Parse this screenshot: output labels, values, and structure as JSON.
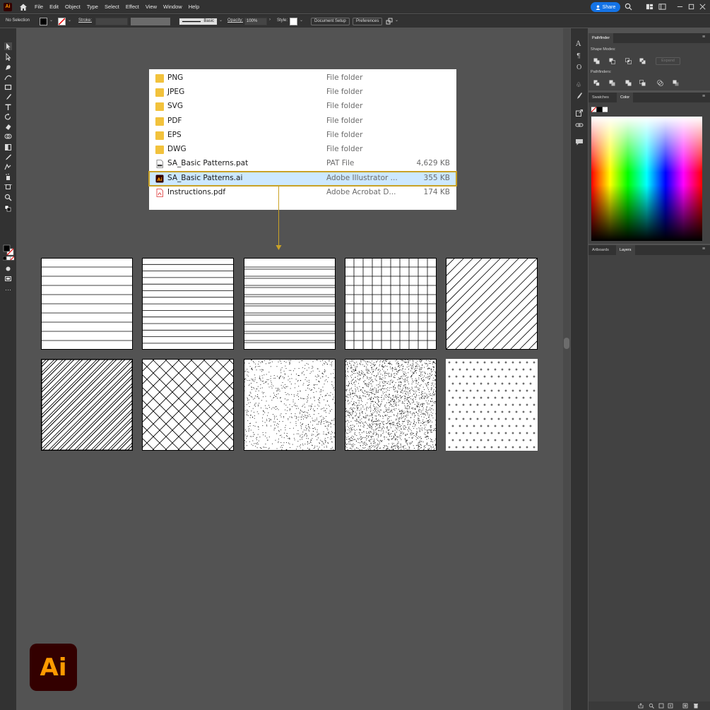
{
  "menubar": {
    "app_icon": "Ai",
    "items": [
      "File",
      "Edit",
      "Object",
      "Type",
      "Select",
      "Effect",
      "View",
      "Window",
      "Help"
    ],
    "share_label": "Share"
  },
  "control_bar": {
    "selection_status": "No Selection",
    "stroke_label": "Stroke:",
    "brush_label": "Basic",
    "opacity_label": "Opacity:",
    "opacity_value": "100%",
    "style_label": "Style:",
    "document_setup_label": "Document Setup",
    "preferences_label": "Preferences"
  },
  "explorer": {
    "rows": [
      {
        "name": "PNG",
        "type": "File folder",
        "size": "",
        "icon": "folder-icon"
      },
      {
        "name": "JPEG",
        "type": "File folder",
        "size": "",
        "icon": "folder-icon"
      },
      {
        "name": "SVG",
        "type": "File folder",
        "size": "",
        "icon": "folder-icon"
      },
      {
        "name": "PDF",
        "type": "File folder",
        "size": "",
        "icon": "folder-icon"
      },
      {
        "name": "EPS",
        "type": "File folder",
        "size": "",
        "icon": "folder-icon"
      },
      {
        "name": "DWG",
        "type": "File folder",
        "size": "",
        "icon": "folder-icon"
      },
      {
        "name": "SA_Basic Patterns.pat",
        "type": "PAT File",
        "size": "4,629 KB",
        "icon": "pat-file-icon"
      },
      {
        "name": "SA_Basic Patterns.ai",
        "type": "Adobe Illustrator ...",
        "size": "355 KB",
        "icon": "illustrator-file-icon",
        "selected": true
      },
      {
        "name": "Instructions.pdf",
        "type": "Adobe Acrobat D...",
        "size": "174 KB",
        "icon": "pdf-file-icon"
      }
    ]
  },
  "patterns": [
    "horizontal-lines-wide",
    "horizontal-lines-medium",
    "horizontal-lines-double",
    "grid",
    "diagonal-lines",
    "diagonal-lines-dense",
    "crosshatch",
    "stipple-light",
    "stipple-dense",
    "plus-dots"
  ],
  "right_panel": {
    "pathfinder_tab": "Pathfinder",
    "shape_modes_label": "Shape Modes:",
    "expand_label": "Expand",
    "pathfinders_label": "Pathfinders:",
    "swatches_tab": "Swatches",
    "color_tab": "Color",
    "artboards_tab": "Artboards",
    "layers_tab": "Layers"
  },
  "logo": {
    "text": "Ai"
  },
  "colors": {
    "accent_gold": "#c9a227",
    "selection_blue": "#cce8ff",
    "share_blue": "#1473e6",
    "ai_brand_bg": "#330000",
    "ai_brand_fg": "#ff9a00"
  }
}
